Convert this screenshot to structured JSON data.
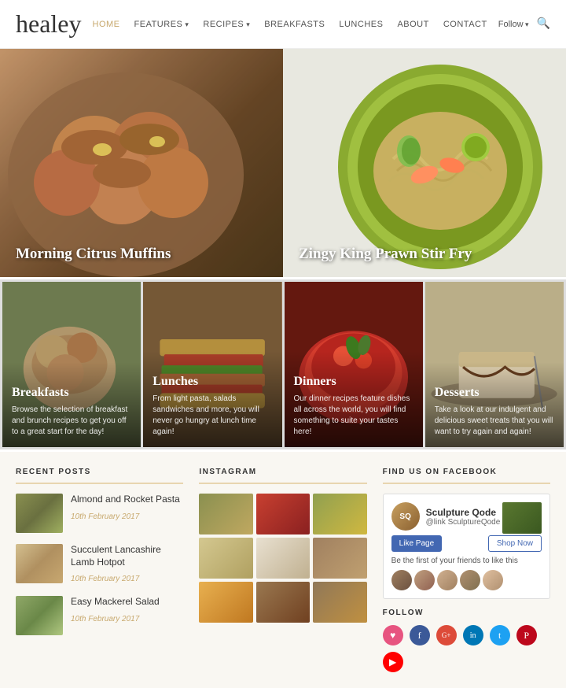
{
  "header": {
    "logo": "healey",
    "nav": [
      {
        "label": "HOME",
        "active": true
      },
      {
        "label": "FEATURES",
        "has_arrow": true
      },
      {
        "label": "RECIPES",
        "has_arrow": true
      },
      {
        "label": "BREAKFASTS"
      },
      {
        "label": "LUNCHES"
      },
      {
        "label": "ABOUT"
      },
      {
        "label": "CONTACT"
      }
    ],
    "follow_label": "Follow",
    "search_title": "Search"
  },
  "hero": [
    {
      "title": "Morning Citrus Muffins"
    },
    {
      "title": "Zingy King Prawn Stir Fry"
    }
  ],
  "categories": [
    {
      "title": "Breakfasts",
      "description": "Browse the selection of breakfast and brunch recipes to get you off to a great start for the day!"
    },
    {
      "title": "Lunches",
      "description": "From light pasta, salads sandwiches and more, you will never go hungry at lunch time again!"
    },
    {
      "title": "Dinners",
      "description": "Our dinner recipes feature dishes all across the world, you will find something to suite your tastes here!"
    },
    {
      "title": "Desserts",
      "description": "Take a look at our indulgent and delicious sweet treats that you will want to try again and again!"
    }
  ],
  "recent_posts": {
    "section_title": "RECENT POSTS",
    "posts": [
      {
        "title": "Almond and Rocket Pasta",
        "date": "10th February 2017"
      },
      {
        "title": "Succulent Lancashire Lamb Hotpot",
        "date": "10th February 2017"
      },
      {
        "title": "Easy Mackerel Salad",
        "date": "10th February 2017"
      }
    ]
  },
  "instagram": {
    "section_title": "INSTAGRAM"
  },
  "facebook": {
    "section_title": "FIND US ON FACEBOOK",
    "page_name": "Sculpture Qode",
    "page_handle": "@link SculptureQode",
    "like_label": "Like Page",
    "shop_label": "Shop Now",
    "promo_text": "Be the first of your friends to like this"
  },
  "follow": {
    "section_title": "FOLLOW",
    "social_icons": [
      "♥",
      "f",
      "G+",
      "in",
      "t",
      "P",
      "▶"
    ]
  }
}
